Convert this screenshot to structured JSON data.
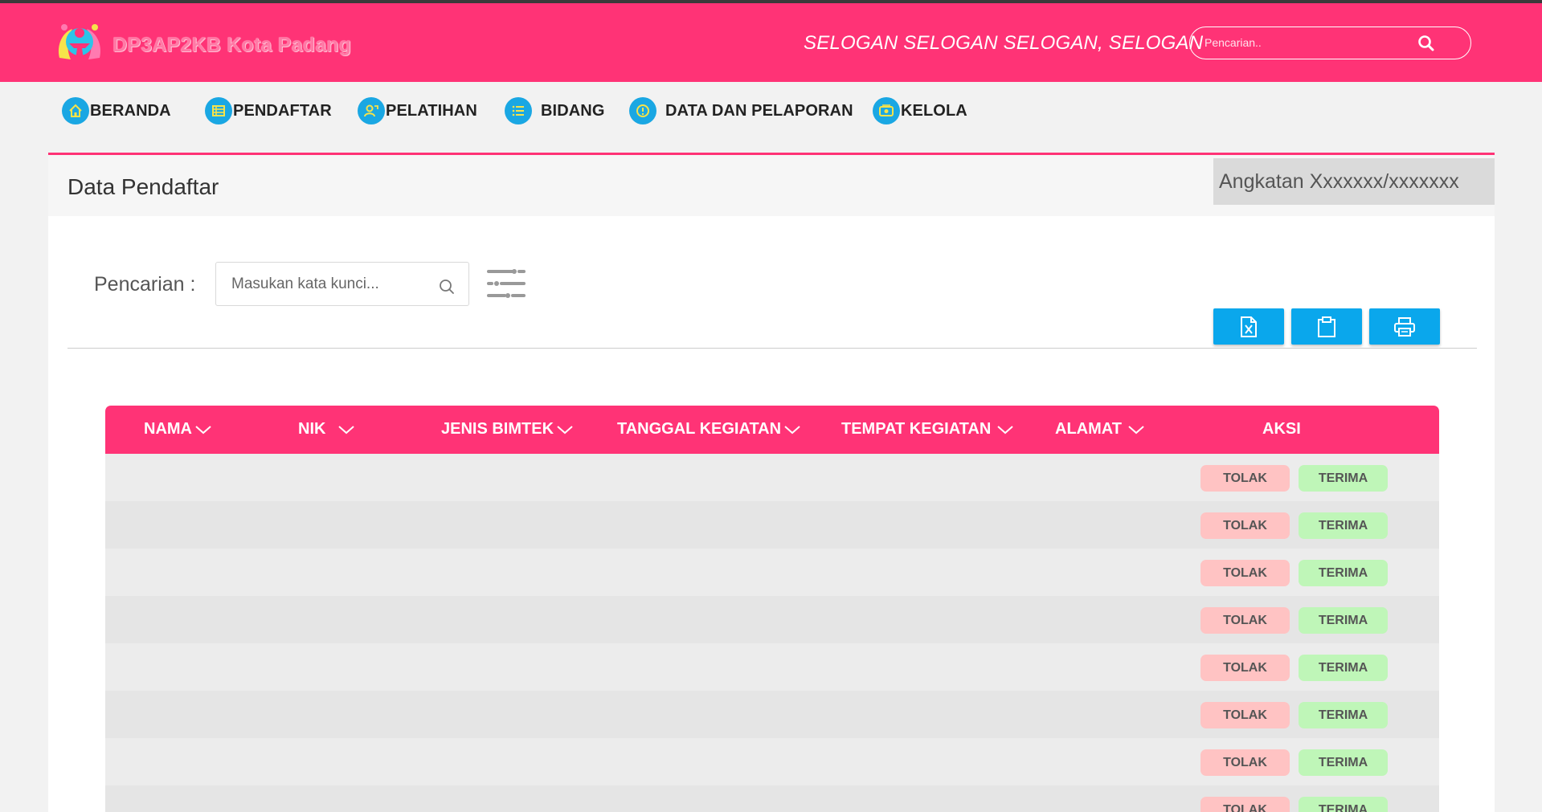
{
  "header": {
    "brand": "DP3AP2KB Kota Padang",
    "slogan": "SELOGAN SELOGAN SELOGAN, SELOGAN",
    "search": {
      "placeholder": "Pencarian..",
      "icon": "search-icon"
    },
    "background": "#ff3376"
  },
  "nav": {
    "items": [
      {
        "label": "BERANDA",
        "icon": "home-icon"
      },
      {
        "label": "PENDAFTAR",
        "icon": "register-list-icon"
      },
      {
        "label": "PELATIHAN",
        "icon": "training-icon"
      },
      {
        "label": "BIDANG",
        "icon": "list-icon"
      },
      {
        "label": "DATA DAN PELAPORAN",
        "icon": "report-icon"
      },
      {
        "label": "KELOLA",
        "icon": "manage-icon"
      }
    ],
    "icon_color": "#1aa7e3"
  },
  "page": {
    "title": "Data Pendaftar",
    "angkatan": "Angkatan Xxxxxxx/xxxxxxx"
  },
  "search": {
    "label": "Pencarian :",
    "placeholder": "Masukan kata kunci..."
  },
  "toolbar": {
    "buttons": [
      {
        "icon": "excel-export-icon"
      },
      {
        "icon": "clipboard-icon"
      },
      {
        "icon": "print-icon"
      }
    ],
    "color": "#0aa7ec"
  },
  "table": {
    "columns": [
      {
        "label": "NAMA",
        "sortable": true
      },
      {
        "label": "NIK",
        "sortable": true
      },
      {
        "label": "JENIS BIMTEK",
        "sortable": true
      },
      {
        "label": "TANGGAL KEGIATAN",
        "sortable": true
      },
      {
        "label": "TEMPAT KEGIATAN",
        "sortable": true
      },
      {
        "label": "ALAMAT",
        "sortable": true
      },
      {
        "label": "AKSI",
        "sortable": false
      }
    ],
    "reject_label": "TOLAK",
    "accept_label": "TERIMA",
    "rows": [
      {
        "nama": "",
        "nik": "",
        "jenis_bimtek": "",
        "tanggal": "",
        "tempat": "",
        "alamat": ""
      },
      {
        "nama": "",
        "nik": "",
        "jenis_bimtek": "",
        "tanggal": "",
        "tempat": "",
        "alamat": ""
      },
      {
        "nama": "",
        "nik": "",
        "jenis_bimtek": "",
        "tanggal": "",
        "tempat": "",
        "alamat": ""
      },
      {
        "nama": "",
        "nik": "",
        "jenis_bimtek": "",
        "tanggal": "",
        "tempat": "",
        "alamat": ""
      },
      {
        "nama": "",
        "nik": "",
        "jenis_bimtek": "",
        "tanggal": "",
        "tempat": "",
        "alamat": ""
      },
      {
        "nama": "",
        "nik": "",
        "jenis_bimtek": "",
        "tanggal": "",
        "tempat": "",
        "alamat": ""
      },
      {
        "nama": "",
        "nik": "",
        "jenis_bimtek": "",
        "tanggal": "",
        "tempat": "",
        "alamat": ""
      },
      {
        "nama": "",
        "nik": "",
        "jenis_bimtek": "",
        "tanggal": "",
        "tempat": "",
        "alamat": ""
      }
    ],
    "header_color": "#ff3376",
    "reject_color": "#ffc3c3",
    "accept_color": "#bff6b8"
  }
}
